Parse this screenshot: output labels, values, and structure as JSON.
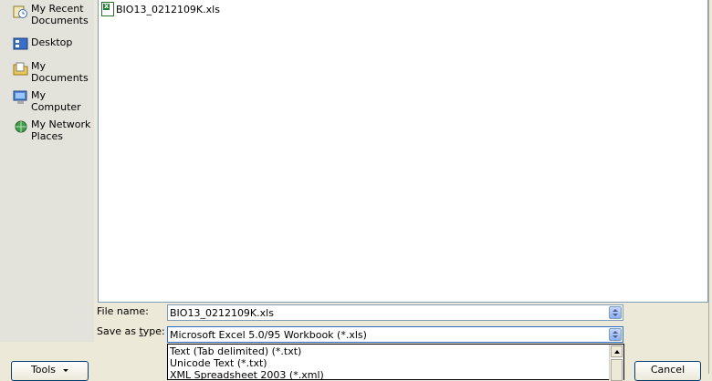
{
  "places": [
    {
      "label": "My Recent Documents",
      "icon": "recent-documents-icon"
    },
    {
      "label": "Desktop",
      "icon": "desktop-icon"
    },
    {
      "label": "My Documents",
      "icon": "my-documents-icon"
    },
    {
      "label": "My Computer",
      "icon": "my-computer-icon"
    },
    {
      "label": "My Network Places",
      "icon": "network-places-icon"
    }
  ],
  "files": [
    {
      "name": "BIO13_0212109K.xls",
      "icon": "excel-file-icon"
    }
  ],
  "file_name": {
    "label": "File name:",
    "value": "BIO13_0212109K.xls"
  },
  "save_as_type": {
    "label_pre": "Save as ",
    "label_key": "t",
    "label_post": "ype:",
    "value": "Microsoft Excel 5.0/95 Workbook (*.xls)",
    "options": [
      "Text (Tab delimited) (*.txt)",
      "Unicode Text (*.txt)",
      "XML Spreadsheet 2003 (*.xml)"
    ]
  },
  "buttons": {
    "tools": "Tools",
    "cancel": "Cancel"
  }
}
